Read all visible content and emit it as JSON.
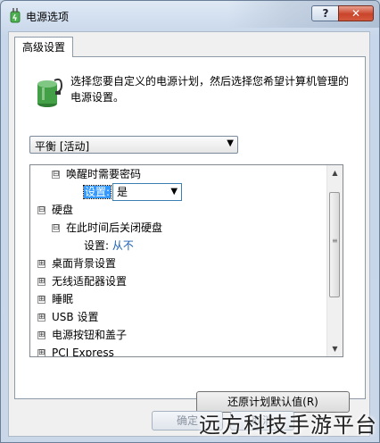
{
  "window": {
    "title": "电源选项",
    "help_label": "?",
    "close_label": "✕"
  },
  "tab": {
    "label": "高级设置"
  },
  "description": "选择您要自定义的电源计划，然后选择您希望计算机管理的电源设置。",
  "plan_select": {
    "value": "平衡 [活动]"
  },
  "tree": {
    "rows": [
      {
        "text": "唤醒时需要密码",
        "expander": "⊟"
      },
      {
        "label": "设置:",
        "value": "是"
      },
      {
        "text": "硬盘",
        "expander": "⊟"
      },
      {
        "text": "在此时间后关闭硬盘",
        "expander": "⊟"
      },
      {
        "label": "设置:",
        "value": "从不"
      },
      {
        "text": "桌面背景设置",
        "expander": "⊞"
      },
      {
        "text": "无线适配器设置",
        "expander": "⊞"
      },
      {
        "text": "睡眠",
        "expander": "⊞"
      },
      {
        "text": "USB 设置",
        "expander": "⊞"
      },
      {
        "text": "电源按钮和盖子",
        "expander": "⊞"
      },
      {
        "text": "PCI Express",
        "expander": "⊞"
      }
    ]
  },
  "restore_button": "还原计划默认值(R)",
  "ok_button": "确定",
  "cancel_button": "取消",
  "watermark": "远方科技手游平台",
  "colors": {
    "accent": "#3399ff",
    "link": "#1a5fb4",
    "close": "#c9442a"
  }
}
